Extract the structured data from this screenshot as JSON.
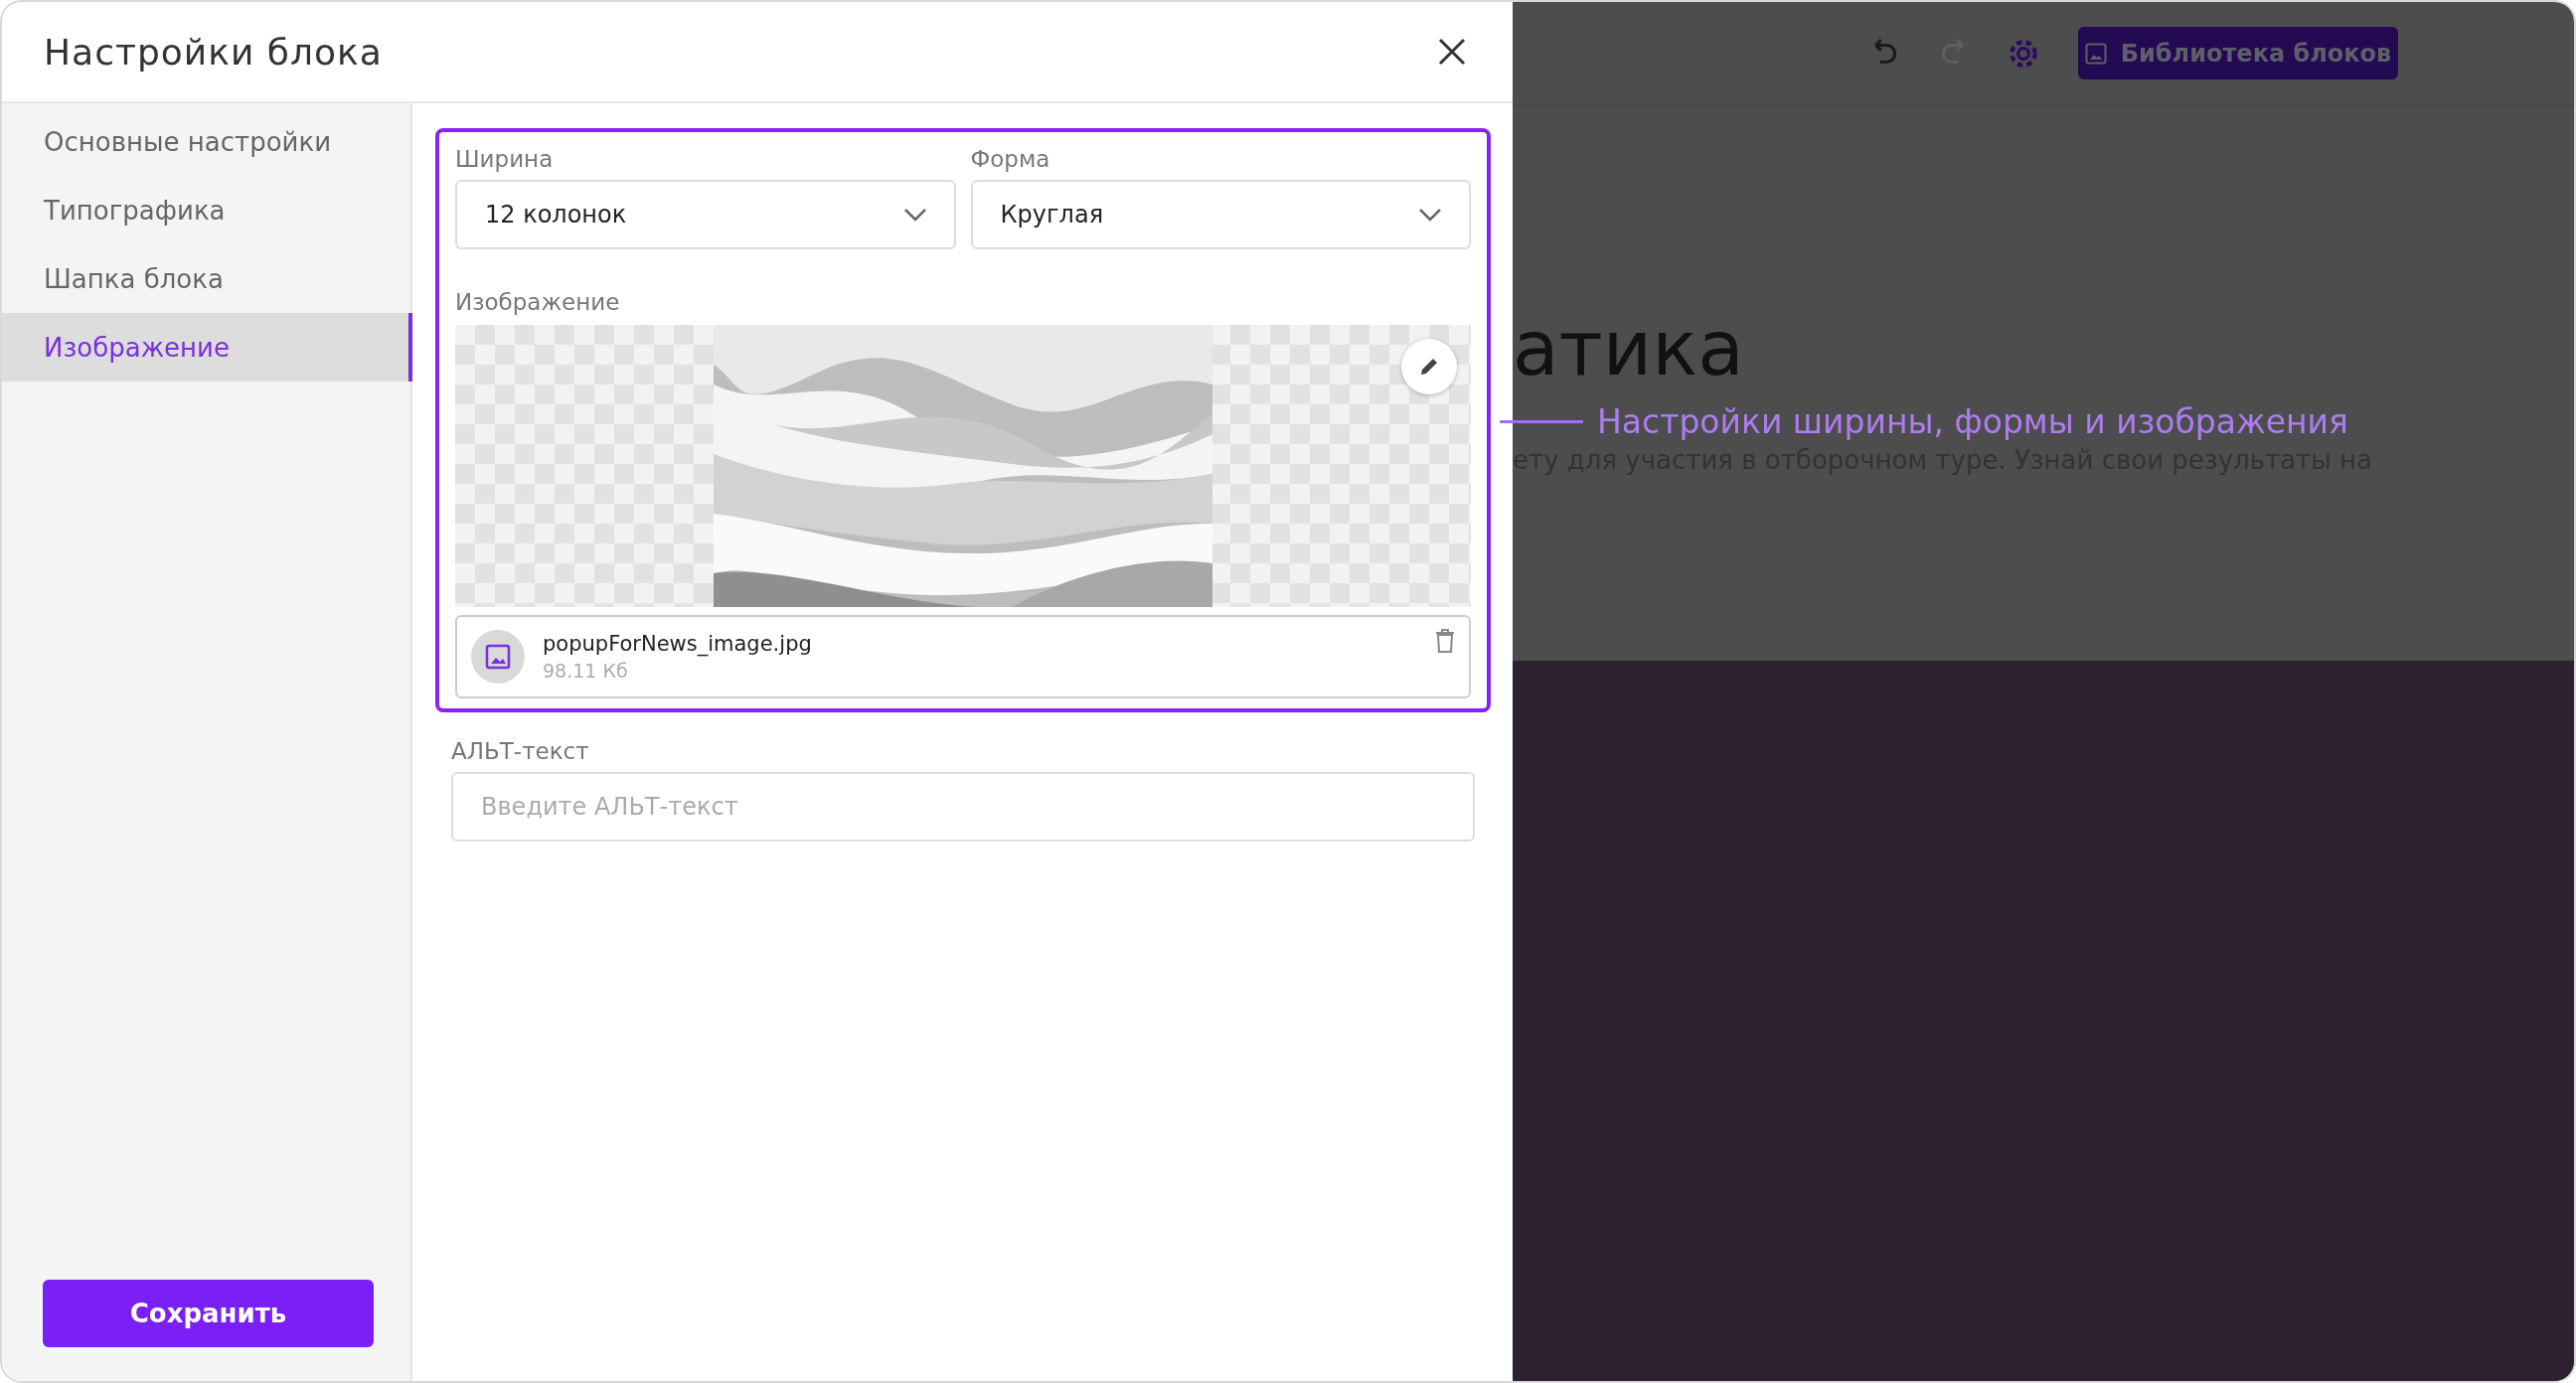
{
  "dialog": {
    "title": "Настройки блока",
    "sidebar": {
      "items": [
        {
          "label": "Основные настройки",
          "selected": false
        },
        {
          "label": "Типографика",
          "selected": false
        },
        {
          "label": "Шапка блока",
          "selected": false
        },
        {
          "label": "Изображение",
          "selected": true
        }
      ]
    },
    "selects": [
      {
        "label": "Ширина",
        "value": "12 колонок"
      },
      {
        "label": "Форма",
        "value": "Круглая"
      }
    ],
    "image": {
      "label": "Изображение",
      "file_name": "popupForNews_image.jpg",
      "file_size": "98.11 Кб"
    },
    "alt_text": {
      "label": "АЛЬТ-текст",
      "placeholder": "Введите АЛЬТ-текст"
    },
    "save_button": "Сохранить"
  },
  "editor": {
    "toolbar": [
      {
        "kind": "undo",
        "disabled": false
      },
      {
        "kind": "redo",
        "disabled": true
      },
      {
        "kind": "settings",
        "disabled": false
      }
    ],
    "library_button": "Библиотека блоков",
    "heading": "атика",
    "body_text": "ету для участия в отборочном туре. Узнай свои результаты на"
  },
  "annotation": "Настройки ширины, формы и изображения"
}
